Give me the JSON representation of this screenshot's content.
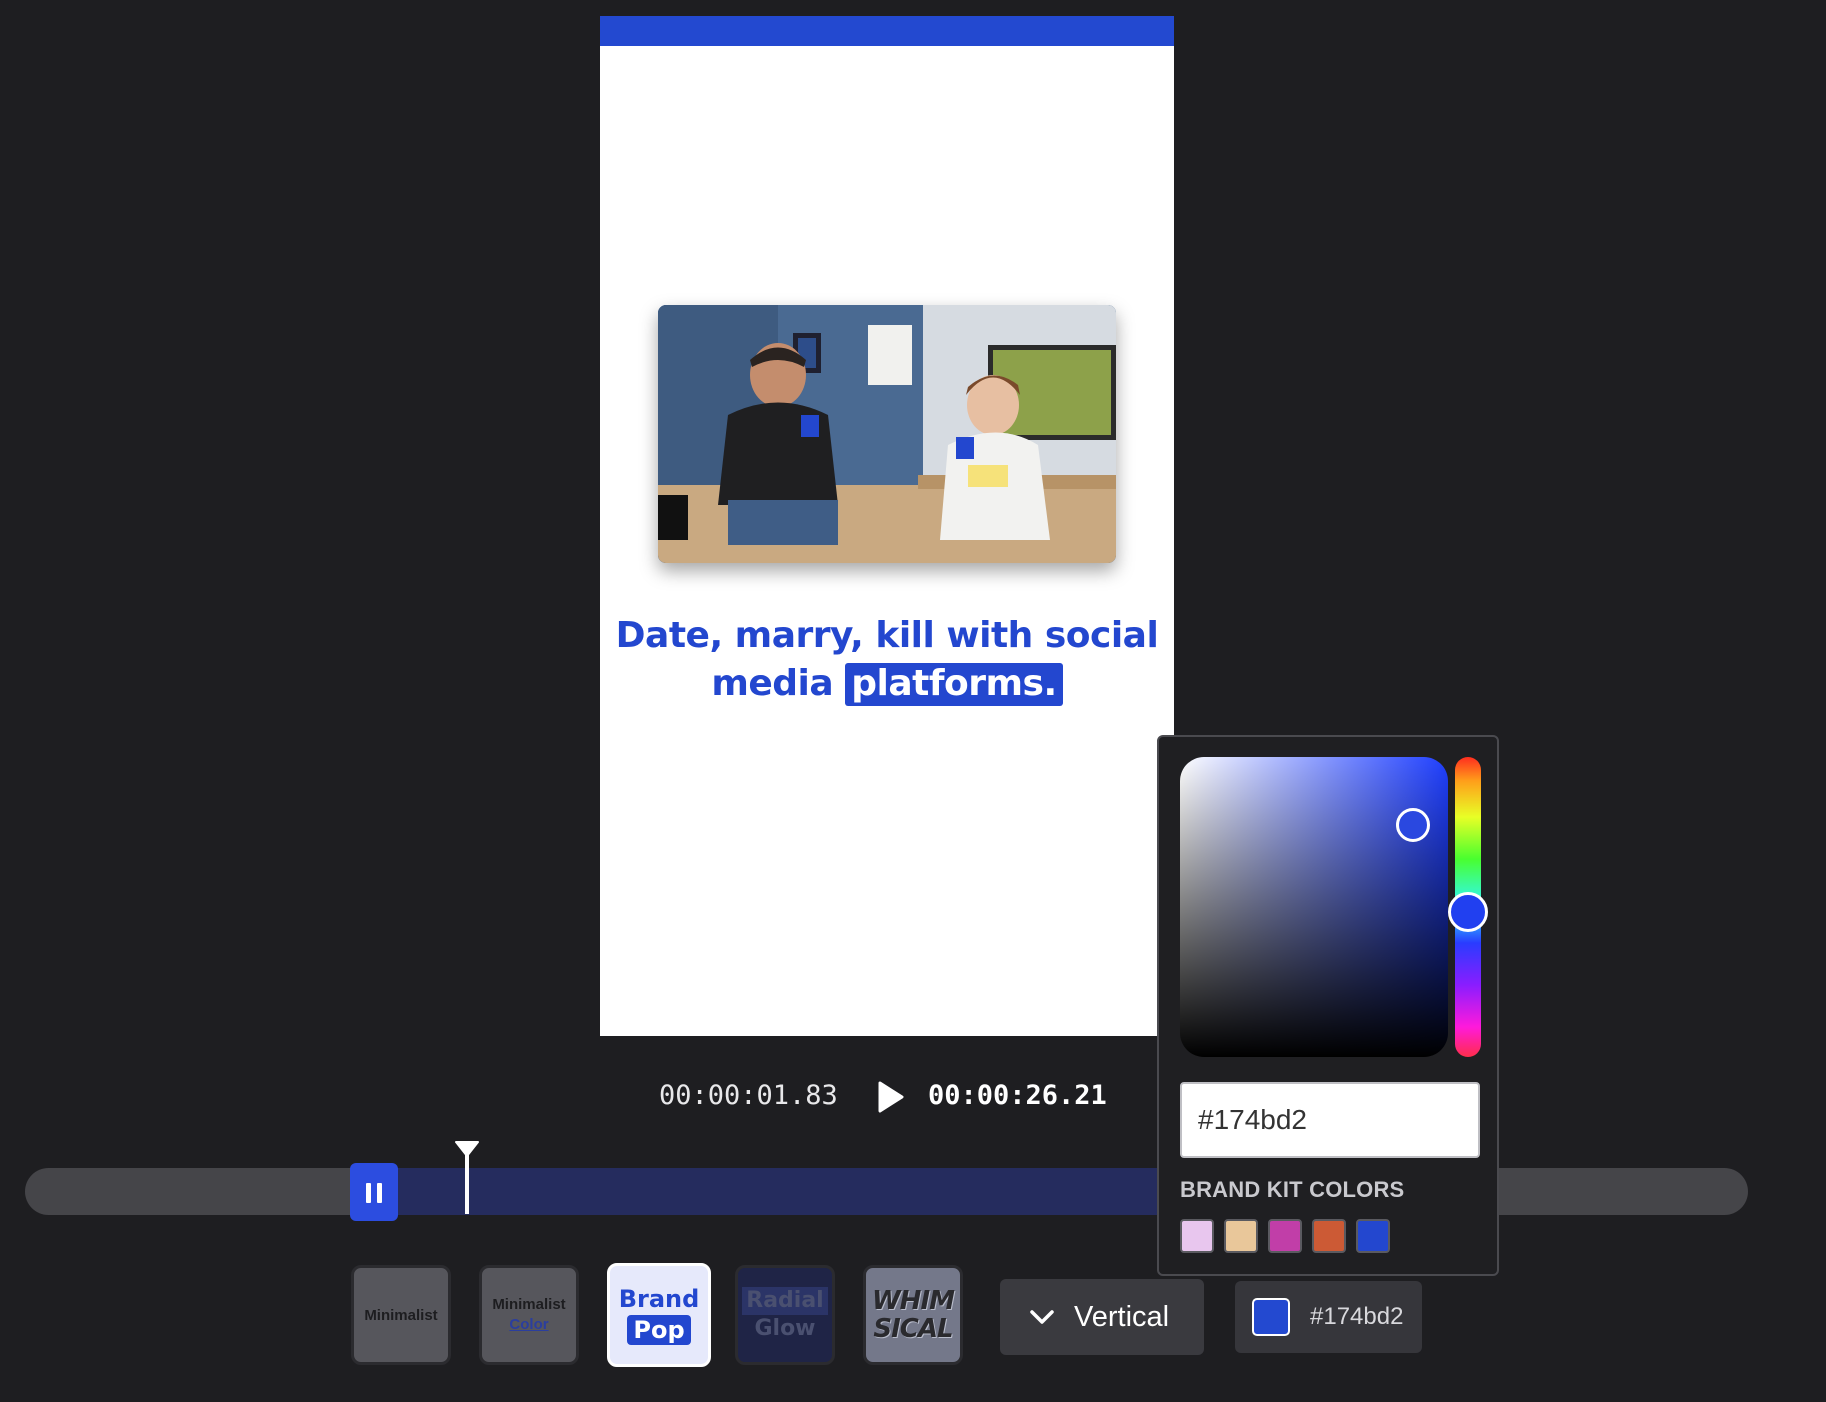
{
  "preview": {
    "caption_plain": "Date, marry, kill with social media",
    "caption_highlight": "platforms.",
    "accent": "#2347cf"
  },
  "playback": {
    "current_time": "00:00:01.83",
    "total_time": "00:00:26.21",
    "play_icon": "play-icon",
    "playhead_position": 0.07
  },
  "styles": {
    "minimalist": "Minimalist",
    "minimalist_color_line1": "Minimalist",
    "minimalist_color_line2": "Color",
    "brand_pop_line1": "Brand",
    "brand_pop_line2": "Pop",
    "radial_glow_line1": "Radial",
    "radial_glow_line2": "Glow",
    "whimsical_line1": "WHIM",
    "whimsical_line2": "SICAL",
    "selected": "Brand Pop"
  },
  "orientation": {
    "label": "Vertical",
    "icon": "chevron-down-icon"
  },
  "color_button": {
    "hex": "#174bd2",
    "swatch": "#2349d0"
  },
  "picker": {
    "hex_value": "#174bd2",
    "brand_kit_label": "BRAND KIT COLORS",
    "brand_kit_colors": [
      "#e8c6ee",
      "#e9c79a",
      "#c13ea8",
      "#cc5a35",
      "#2347cf"
    ]
  }
}
